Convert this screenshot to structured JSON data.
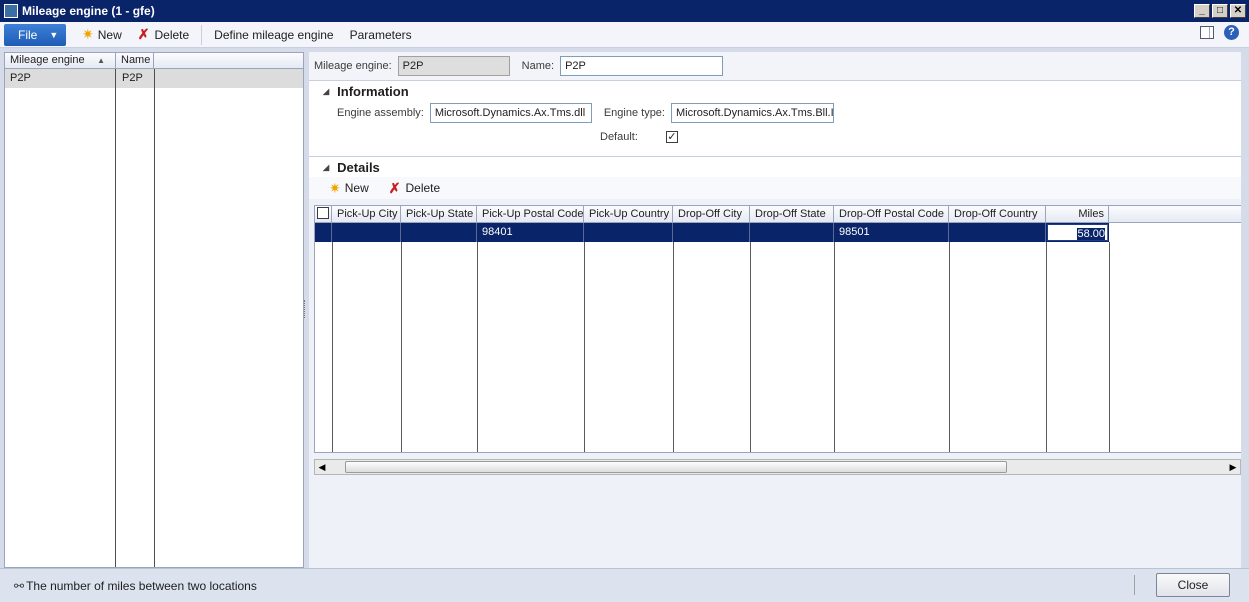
{
  "window": {
    "title": "Mileage engine (1 - gfe)",
    "minimize": "_",
    "maximize": "□",
    "close": "✕"
  },
  "toolbar": {
    "file_label": "File",
    "new_label": "New",
    "delete_label": "Delete",
    "define_label": "Define mileage engine",
    "parameters_label": "Parameters"
  },
  "list": {
    "columns": [
      "Mileage engine",
      "Name"
    ],
    "rows": [
      {
        "engine": "P2P",
        "name": "P2P"
      }
    ]
  },
  "header": {
    "engine_label": "Mileage engine:",
    "engine_value": "P2P",
    "name_label": "Name:",
    "name_value": "P2P"
  },
  "information": {
    "title": "Information",
    "assembly_label": "Engine assembly:",
    "assembly_value": "Microsoft.Dynamics.Ax.Tms.dll",
    "type_label": "Engine type:",
    "type_value": "Microsoft.Dynamics.Ax.Tms.Bll.I",
    "default_label": "Default:",
    "default_checked": true
  },
  "details": {
    "title": "Details",
    "new_label": "New",
    "delete_label": "Delete",
    "columns": [
      "Pick-Up City",
      "Pick-Up State",
      "Pick-Up Postal Code",
      "Pick-Up Country",
      "Drop-Off City",
      "Drop-Off State",
      "Drop-Off Postal Code",
      "Drop-Off Country",
      "Miles"
    ],
    "rows": [
      {
        "pickup_city": "",
        "pickup_state": "",
        "pickup_postal": "98401",
        "pickup_country": "",
        "dropoff_city": "",
        "dropoff_state": "",
        "dropoff_postal": "98501",
        "dropoff_country": "",
        "miles": "58.00"
      }
    ]
  },
  "status": {
    "text": "The number of miles between two locations",
    "close_label": "Close"
  },
  "colors": {
    "title_bar": "#0a246a",
    "file_button": "#1f5cb6",
    "selected_row": "#0a246a"
  }
}
